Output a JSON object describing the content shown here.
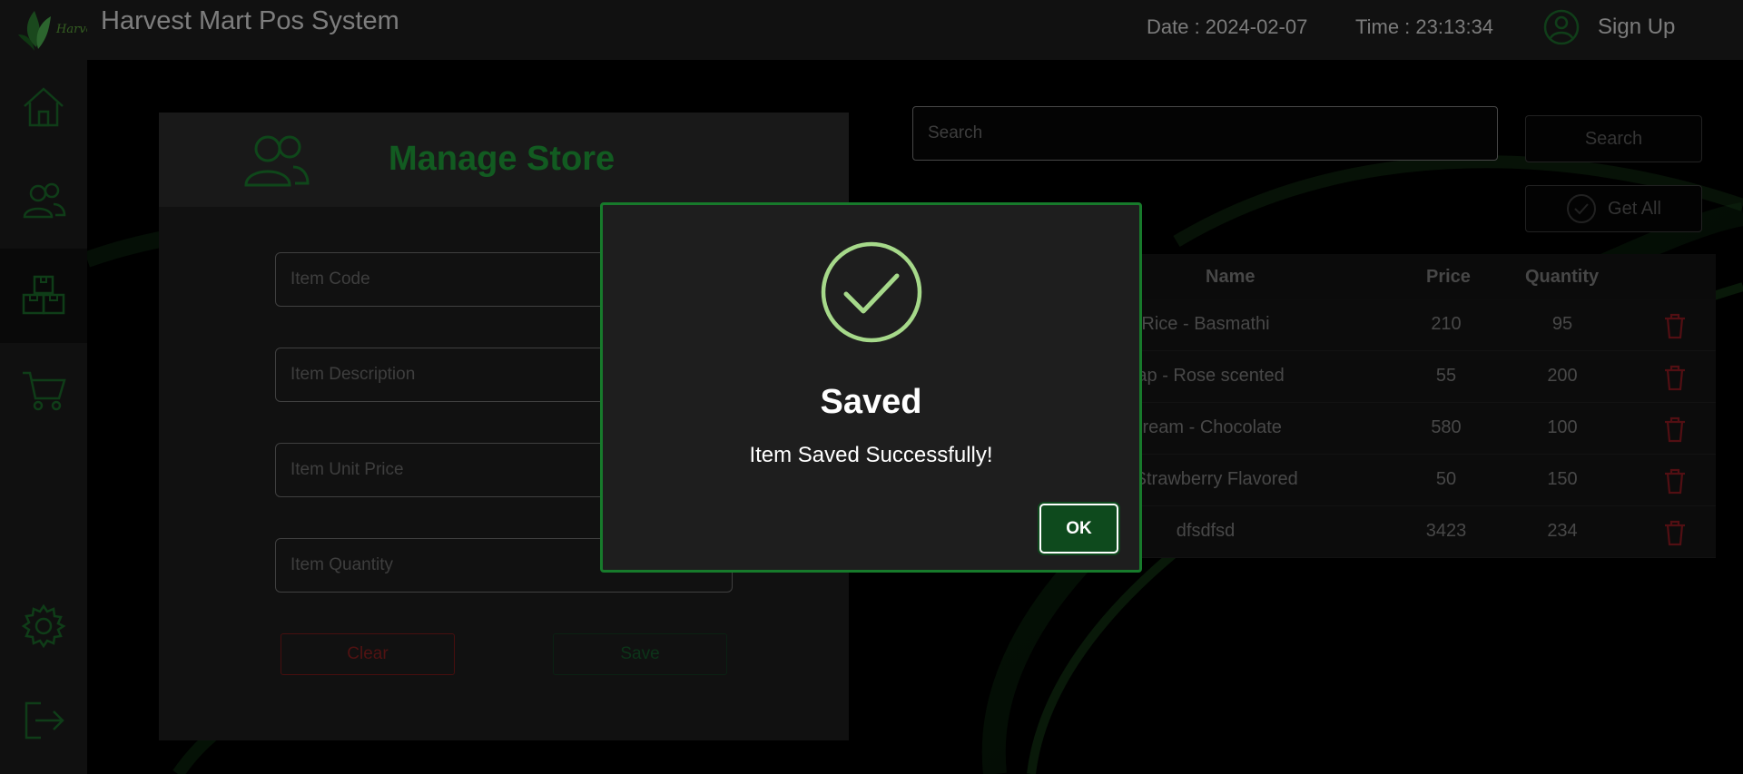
{
  "app": {
    "title": "Harvest Mart Pos System",
    "logo_text": "Harvest",
    "date_label": "Date : 2024-02-07",
    "time_label": "Time : 23:13:34",
    "signup_label": "Sign Up"
  },
  "sidebar": {
    "items": [
      {
        "name": "home",
        "icon": "home-icon"
      },
      {
        "name": "customers",
        "icon": "users-icon"
      },
      {
        "name": "store",
        "icon": "boxes-icon",
        "active": true
      },
      {
        "name": "orders",
        "icon": "cart-icon"
      },
      {
        "name": "settings",
        "icon": "gear-icon"
      },
      {
        "name": "logout",
        "icon": "logout-icon"
      }
    ]
  },
  "form": {
    "title": "Manage Store",
    "item_code_placeholder": "Item Code",
    "item_description_placeholder": "Item Description",
    "item_unit_price_placeholder": "Item Unit Price",
    "item_quantity_placeholder": "Item Quantity",
    "clear_label": "Clear",
    "save_label": "Save"
  },
  "search": {
    "placeholder": "Search",
    "button_label": "Search",
    "get_all_label": "Get All"
  },
  "table": {
    "headers": {
      "name": "Name",
      "price": "Price",
      "quantity": "Quantity"
    },
    "rows": [
      {
        "name": "Rice - Basmathi",
        "price": "210",
        "quantity": "95"
      },
      {
        "name": "oap - Rose scented",
        "price": "55",
        "quantity": "200"
      },
      {
        "name": "Cream - Chocolate",
        "price": "580",
        "quantity": "100"
      },
      {
        "name": "t - Strawberry Flavored",
        "price": "50",
        "quantity": "150"
      },
      {
        "name": "dfsdfsd",
        "price": "3423",
        "quantity": "234"
      }
    ]
  },
  "dialog": {
    "title": "Saved",
    "message": "Item Saved Successfully!",
    "ok_label": "OK"
  },
  "colors": {
    "accent_green": "#1f9d3a",
    "check_green": "#a6d98a",
    "danger_red": "#b3202a",
    "dialog_border": "#177a2b"
  }
}
